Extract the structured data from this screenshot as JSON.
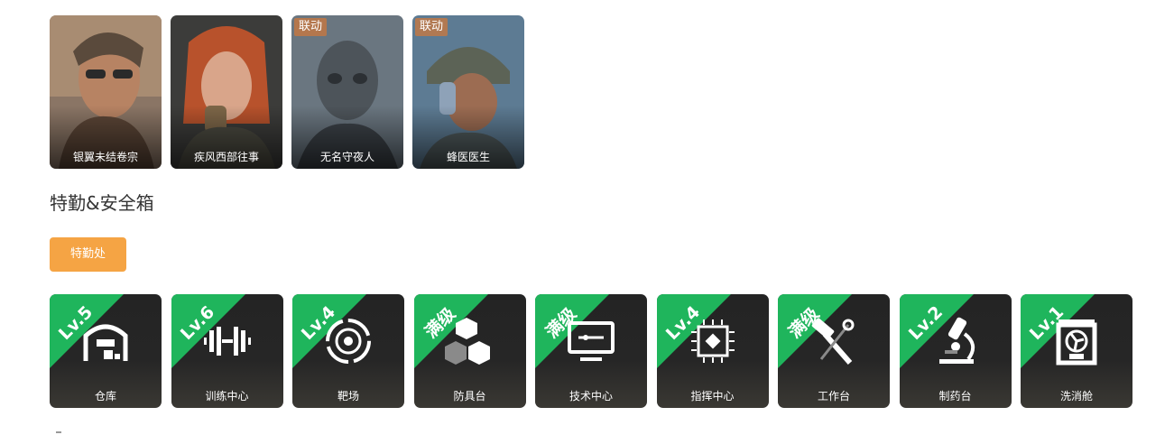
{
  "operators": [
    {
      "name": "银翼未结卷宗",
      "tag": ""
    },
    {
      "name": "疾风西部往事",
      "tag": ""
    },
    {
      "name": "无名守夜人",
      "tag": "联动"
    },
    {
      "name": "蜂医医生",
      "tag": "联动"
    }
  ],
  "section": {
    "title": "特勤&安全箱"
  },
  "agent_button": {
    "label": "特勤处"
  },
  "facilities": [
    {
      "level": "Lv.5",
      "name": "仓库",
      "icon": "warehouse-icon"
    },
    {
      "level": "Lv.6",
      "name": "训练中心",
      "icon": "dumbbell-icon"
    },
    {
      "level": "Lv.4",
      "name": "靶场",
      "icon": "target-icon"
    },
    {
      "level": "满级",
      "name": "防具台",
      "icon": "cubes-icon"
    },
    {
      "level": "满级",
      "name": "技术中心",
      "icon": "monitor-icon"
    },
    {
      "level": "Lv.4",
      "name": "指挥中心",
      "icon": "chip-icon"
    },
    {
      "level": "满级",
      "name": "工作台",
      "icon": "tools-icon"
    },
    {
      "level": "Lv.2",
      "name": "制药台",
      "icon": "microscope-icon"
    },
    {
      "level": "Lv.1",
      "name": "洗消舱",
      "icon": "fan-chamber-icon"
    }
  ],
  "colors": {
    "accent_button": "#f5a444",
    "level_ribbon": "#1fb55c",
    "tile_bg": "#252525"
  }
}
